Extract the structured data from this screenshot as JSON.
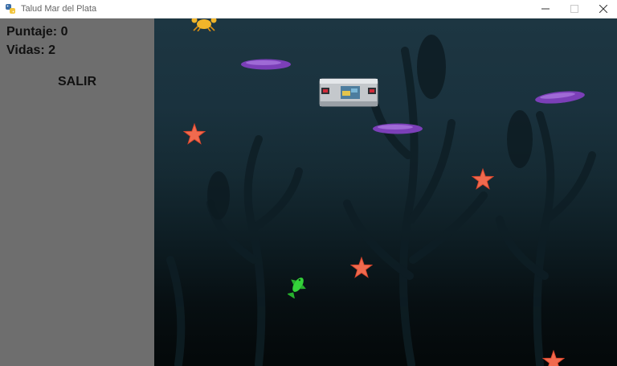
{
  "window": {
    "title": "Talud Mar del Plata",
    "icon": "python-icon"
  },
  "hud": {
    "score_text": "Puntaje: 0",
    "lives_text": "Vidas: 2",
    "exit_label": "SALIR"
  },
  "colors": {
    "sidebar_bg": "#6e6e6e",
    "starfish": "#f06a4e",
    "sea_slug": "#7b3fb8",
    "crab": "#f1b52a",
    "player_fish": "#34d23a"
  },
  "sprites": [
    "crab",
    "sea-slug",
    "sea-slug",
    "sea-slug",
    "submarine",
    "starfish",
    "starfish",
    "starfish",
    "starfish",
    "player-fish"
  ]
}
